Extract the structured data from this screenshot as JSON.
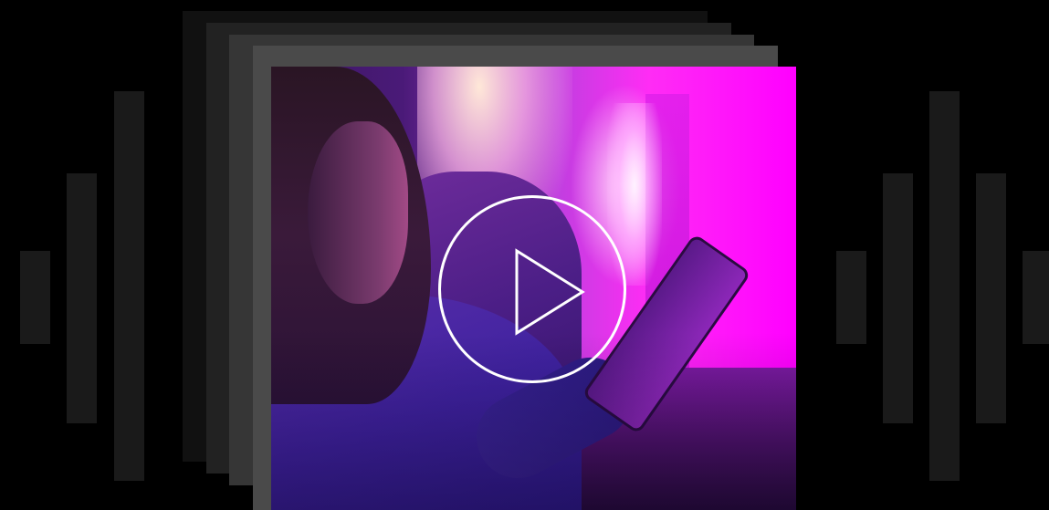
{
  "colors": {
    "background": "#000000",
    "waveform_bar": "#1a1a1a",
    "stack_layers": [
      "#111111",
      "#222222",
      "#363636",
      "#4a4a4a"
    ],
    "play_icon": "#ffffff"
  },
  "icons": {
    "play": "play-icon"
  }
}
